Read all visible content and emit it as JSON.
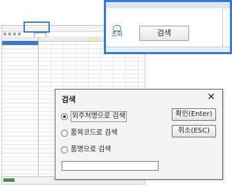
{
  "zoom_panel": {
    "icon_label": "조회",
    "search_button_label": "검색"
  },
  "dialog": {
    "title": "검색",
    "close_glyph": "✕",
    "options": [
      {
        "label": "외주처명으로 검색",
        "selected": true
      },
      {
        "label": "품목코드로 검색",
        "selected": false
      },
      {
        "label": "품명으로 검색",
        "selected": false
      }
    ],
    "ok_label": "확인(Enter)",
    "cancel_label": "취소(ESC)",
    "search_value": ""
  },
  "colors": {
    "highlight": "#2f7ad8",
    "selected_row": "#3c78c8"
  }
}
